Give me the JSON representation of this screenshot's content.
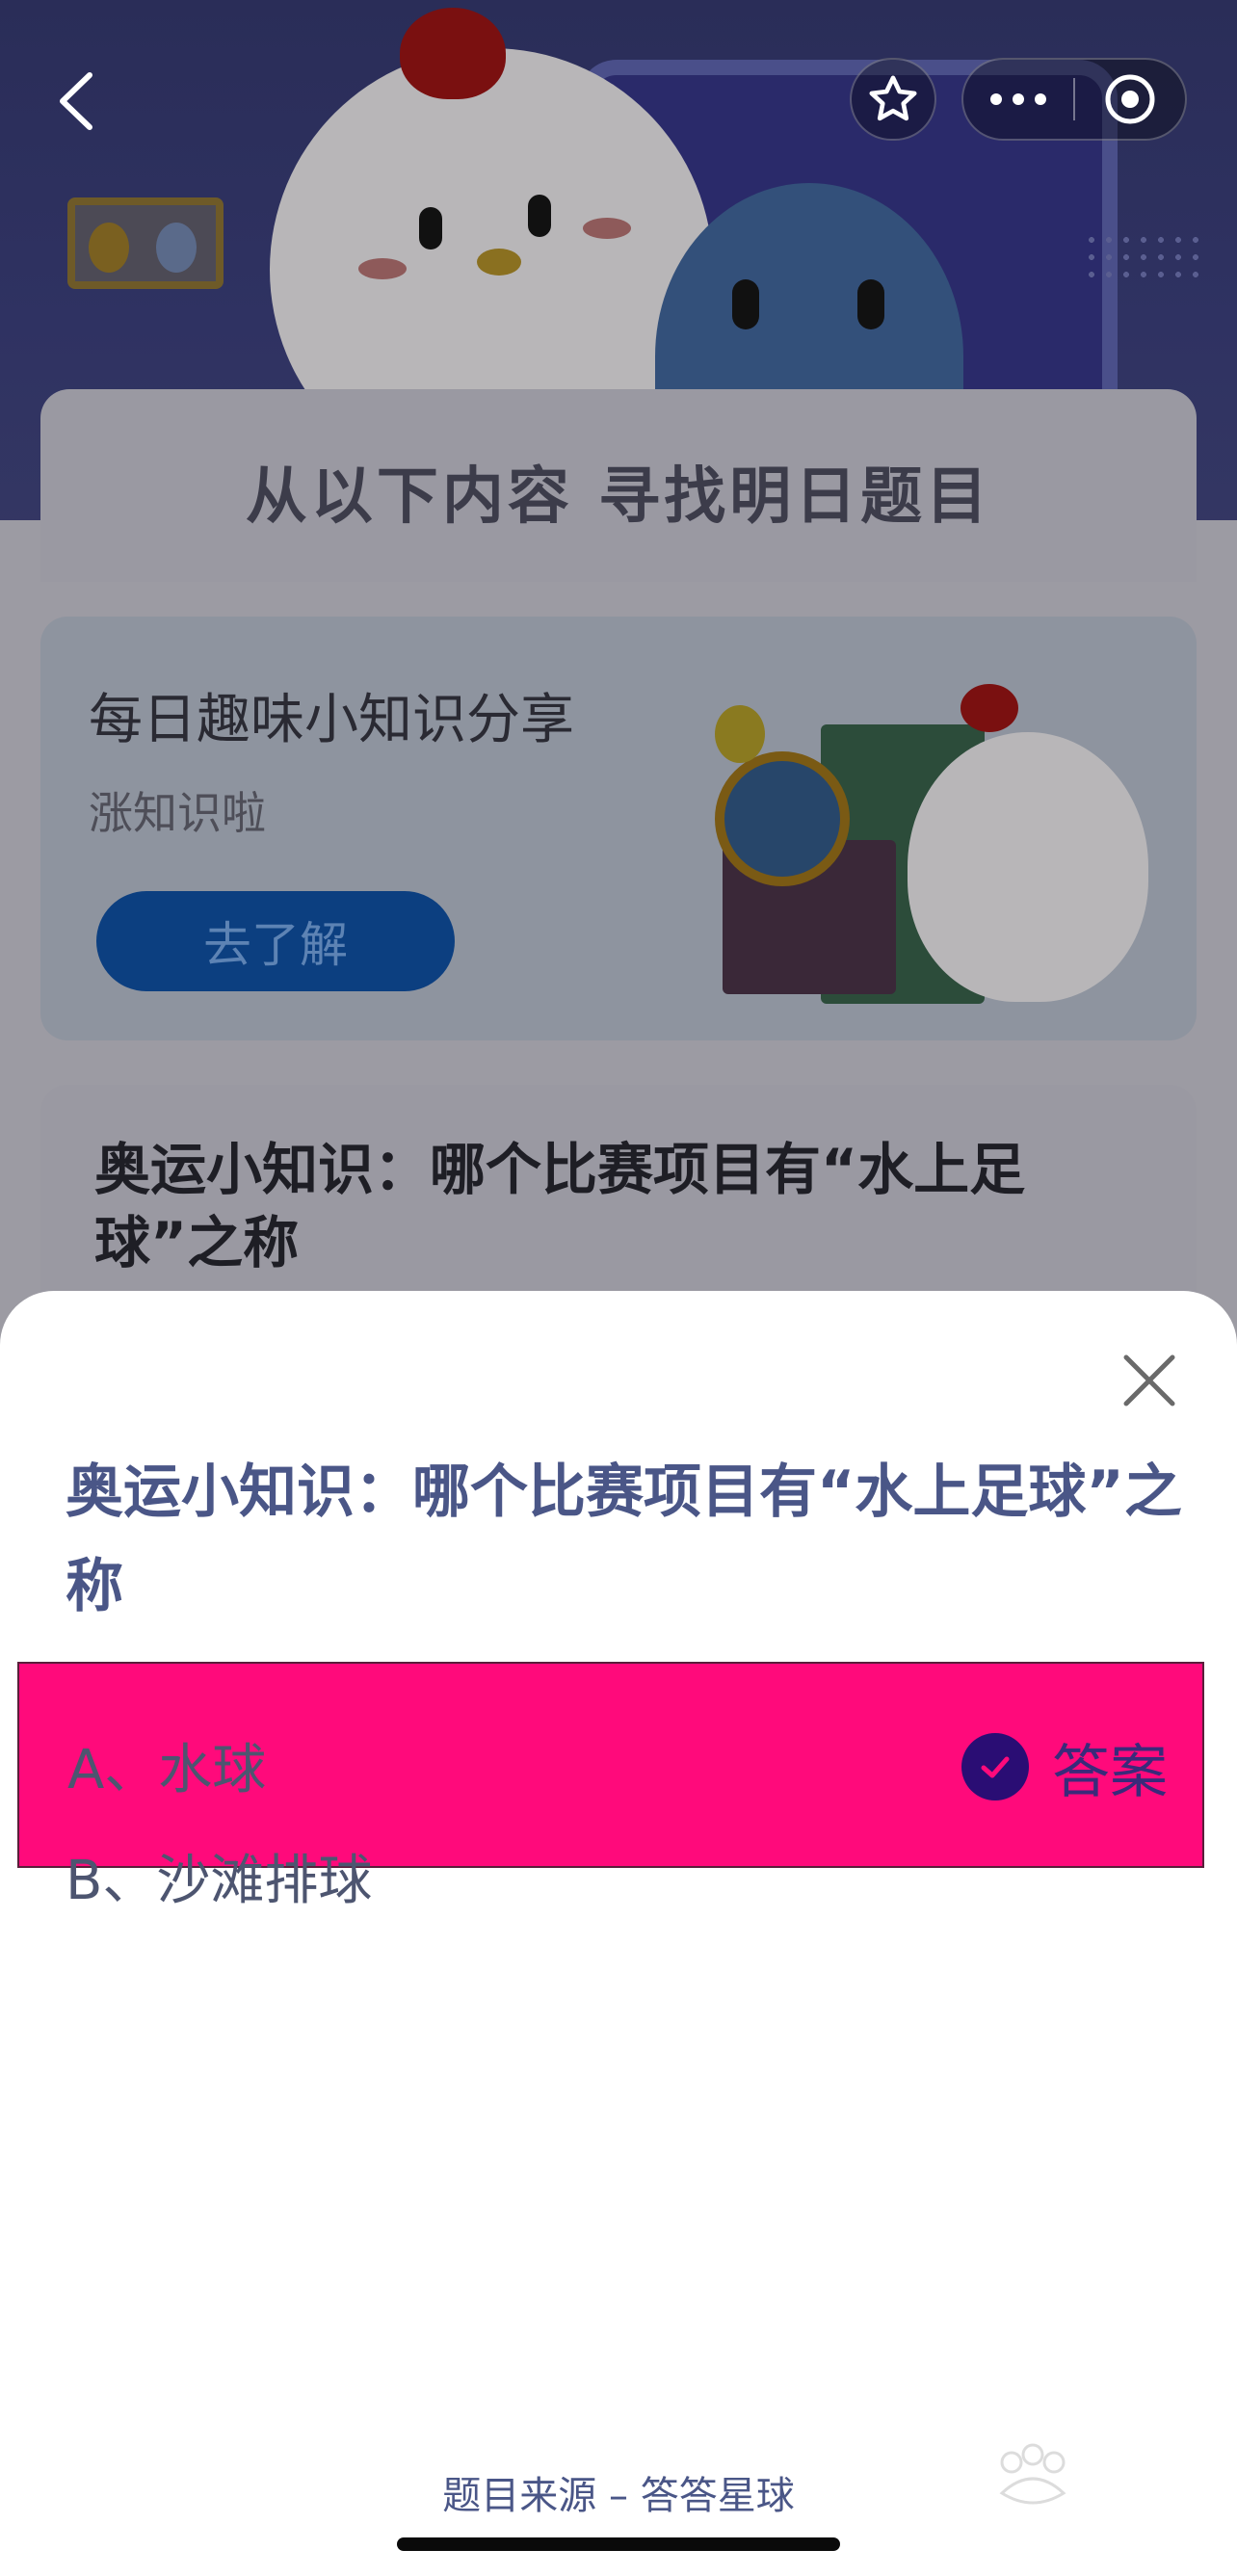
{
  "header": {
    "back_icon": "chevron-left-icon",
    "favorite_icon": "star-icon",
    "more_icon": "more-horizontal-icon",
    "record_icon": "target-circle-icon"
  },
  "banner": {
    "title": "从以下内容  寻找明日题目"
  },
  "card_tips": {
    "title": "每日趣味小知识分享",
    "subtitle": "涨知识啦",
    "button_label": "去了解"
  },
  "card_question": {
    "title": "奥运小知识：哪个比赛项目有“水上足球”之称"
  },
  "sheet": {
    "close_icon": "close-icon",
    "question": "奥运小知识：哪个比赛项目有“水上足球”之称",
    "options": [
      {
        "label": "A、水球",
        "is_answer": true
      },
      {
        "label": "B、沙滩排球",
        "is_answer": false
      }
    ],
    "answer_label": "答案",
    "source": "题目来源 – 答答星球"
  },
  "colors": {
    "answer_highlight": "#ff0a7b",
    "question_text": "#4a5687",
    "check_circle": "#2a0d74"
  }
}
